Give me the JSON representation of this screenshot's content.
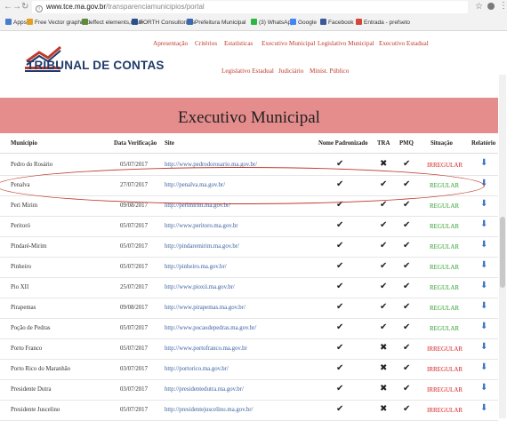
{
  "browser": {
    "url_host": "www.tce.ma.gov.br",
    "url_path": "/transparenciamunicipios/portal",
    "bookmarks": [
      {
        "label": "Apps",
        "color": "#4a7bd0"
      },
      {
        "label": "Free Vector graphic d",
        "color": "#e0a020"
      },
      {
        "label": "effect elements,mate",
        "color": "#5a8a3a"
      },
      {
        "label": "FORTH Consultoria e",
        "color": "#2a4f8a"
      },
      {
        "label": "Prefeitura Municipal",
        "color": "#3a6ab0"
      },
      {
        "label": "(3) WhatsApp",
        "color": "#2bb741"
      },
      {
        "label": "Google",
        "color": "#4285f4"
      },
      {
        "label": "Facebook",
        "color": "#3b5998"
      },
      {
        "label": "Entrada - prefseto",
        "color": "#d44638"
      }
    ]
  },
  "header": {
    "logo_text": "TRIBUNAL DE CONTAS",
    "nav_row1": [
      "Apresentação",
      "Critérios",
      "Estatísticas",
      "Executivo Municipal",
      "Legislativo Municipal",
      "Executivo Estadual"
    ],
    "nav_row2": [
      "Legislativo Estadual",
      "Judiciário",
      "Minist. Público"
    ]
  },
  "banner_title": "Executivo Municipal",
  "table": {
    "headers": [
      "Município",
      "Data Verificação",
      "Site",
      "Nome Padronizado",
      "TRA",
      "PMQ",
      "Situação",
      "Relatório"
    ],
    "rows": [
      {
        "municipio": "Pedro do Rosário",
        "data": "05/07/2017",
        "site": "http://www.pedrodorosario.ma.gov.br/",
        "nome": "✔",
        "tra": "✖",
        "pmq": "✔",
        "situacao": "IRREGULAR",
        "status": "bad"
      },
      {
        "municipio": "Penalva",
        "data": "27/07/2017",
        "site": "http://penalva.ma.gov.br/",
        "nome": "✔",
        "tra": "✔",
        "pmq": "✔",
        "situacao": "REGULAR",
        "status": "ok"
      },
      {
        "municipio": "Peri Mirim",
        "data": "09/08/2017",
        "site": "http://perimirim.ma.gov.br/",
        "nome": "✔",
        "tra": "✔",
        "pmq": "✔",
        "situacao": "REGULAR",
        "status": "ok"
      },
      {
        "municipio": "Peritoró",
        "data": "05/07/2017",
        "site": "http://www.peritoro.ma.gov.br",
        "nome": "✔",
        "tra": "✔",
        "pmq": "✔",
        "situacao": "REGULAR",
        "status": "ok"
      },
      {
        "municipio": "Pindaré-Mirim",
        "data": "05/07/2017",
        "site": "http://pindaremirim.ma.gov.br/",
        "nome": "✔",
        "tra": "✔",
        "pmq": "✔",
        "situacao": "REGULAR",
        "status": "ok"
      },
      {
        "municipio": "Pinheiro",
        "data": "05/07/2017",
        "site": "http://pinheiro.ma.gov.br/",
        "nome": "✔",
        "tra": "✔",
        "pmq": "✔",
        "situacao": "REGULAR",
        "status": "ok"
      },
      {
        "municipio": "Pio XII",
        "data": "25/07/2017",
        "site": "http://www.pioxii.ma.gov.br/",
        "nome": "✔",
        "tra": "✔",
        "pmq": "✔",
        "situacao": "REGULAR",
        "status": "ok"
      },
      {
        "municipio": "Pirapemas",
        "data": "09/08/2017",
        "site": "http://www.pirapemas.ma.gov.br/",
        "nome": "✔",
        "tra": "✔",
        "pmq": "✔",
        "situacao": "REGULAR",
        "status": "ok"
      },
      {
        "municipio": "Poção de Pedras",
        "data": "05/07/2017",
        "site": "http://www.pocaodepedras.ma.gov.br/",
        "nome": "✔",
        "tra": "✔",
        "pmq": "✔",
        "situacao": "REGULAR",
        "status": "ok"
      },
      {
        "municipio": "Porto Franco",
        "data": "05/07/2017",
        "site": "http://www.portofranco.ma.gov.br",
        "nome": "✔",
        "tra": "✖",
        "pmq": "✔",
        "situacao": "IRREGULAR",
        "status": "bad"
      },
      {
        "municipio": "Porto Rico do Maranhão",
        "data": "03/07/2017",
        "site": "http://portorico.ma.gov.br/",
        "nome": "✔",
        "tra": "✖",
        "pmq": "✔",
        "situacao": "IRREGULAR",
        "status": "bad"
      },
      {
        "municipio": "Presidente Dutra",
        "data": "03/07/2017",
        "site": "http://presidentedutra.ma.gov.br/",
        "nome": "✔",
        "tra": "✖",
        "pmq": "✔",
        "situacao": "IRREGULAR",
        "status": "bad"
      },
      {
        "municipio": "Presidente Juscelino",
        "data": "05/07/2017",
        "site": "http://presidentejuscelino.ma.gov.br/",
        "nome": "✔",
        "tra": "✖",
        "pmq": "✔",
        "situacao": "IRREGULAR",
        "status": "bad"
      }
    ]
  },
  "icons": {
    "download": "download-icon",
    "check": "check-icon",
    "cross": "cross-icon"
  },
  "colors": {
    "banner": "#e58c8c",
    "nav": "#c0392b",
    "regular": "#2e9e2e",
    "irregular": "#d62020",
    "link": "#3a5fa0"
  }
}
